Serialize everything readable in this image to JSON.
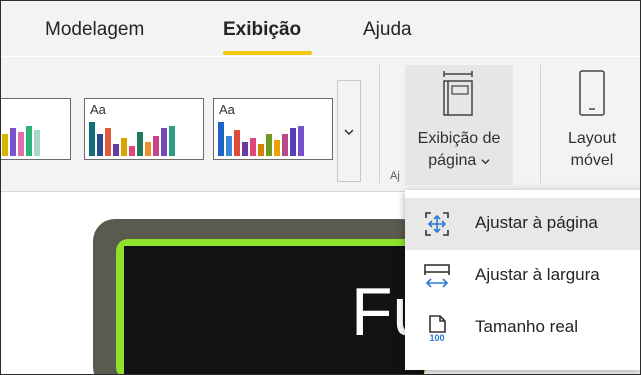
{
  "tabs": [
    {
      "label": "Modelagem",
      "active": false
    },
    {
      "label": "Exibição",
      "active": true
    },
    {
      "label": "Ajuda",
      "active": false
    }
  ],
  "themes": {
    "thumb_text": "Aa",
    "more_icon": "chevron-down-icon"
  },
  "ribbon": {
    "page_view": {
      "line1": "Exibição de",
      "line2": "página"
    },
    "mobile_layout": {
      "line1": "Layout",
      "line2": "móvel"
    },
    "group_label_fragment": "Aj"
  },
  "dropdown": {
    "items": [
      {
        "label": "Ajustar à página",
        "icon": "fit-page-icon",
        "selected": true
      },
      {
        "label": "Ajustar à largura",
        "icon": "fit-width-icon",
        "selected": false
      },
      {
        "label": "Tamanho real",
        "icon": "actual-size-icon",
        "selected": false,
        "icon_text": "100"
      }
    ]
  },
  "report": {
    "visible_text": "Fu"
  },
  "colors": {
    "accent": "#f2c811",
    "report_green": "#8ee32a"
  }
}
